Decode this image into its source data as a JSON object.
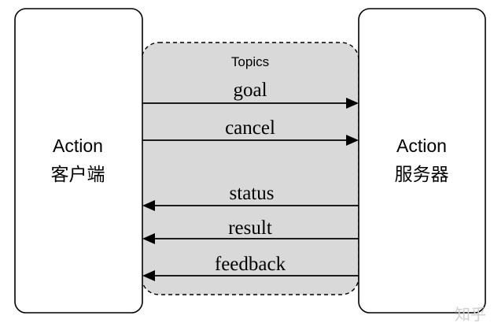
{
  "client": {
    "title": "Action",
    "subtitle": "客户端"
  },
  "server": {
    "title": "Action",
    "subtitle": "服务器"
  },
  "topics": {
    "title": "Topics"
  },
  "messages": [
    {
      "label": "goal",
      "direction": "client-to-server"
    },
    {
      "label": "cancel",
      "direction": "client-to-server"
    },
    {
      "label": "status",
      "direction": "server-to-client"
    },
    {
      "label": "result",
      "direction": "server-to-client"
    },
    {
      "label": "feedback",
      "direction": "server-to-client"
    }
  ],
  "watermark": "知乎"
}
